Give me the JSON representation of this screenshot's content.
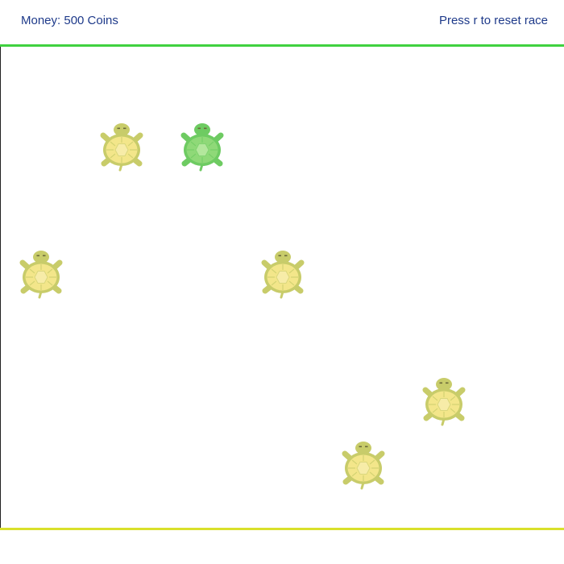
{
  "hud": {
    "money": "Money: 500 Coins",
    "reset_hint": "Press r to reset race"
  },
  "colors": {
    "text": "#1e3a8a",
    "start_line": "#3fd13f",
    "finish_line": "#d9e02b",
    "turtle_default_body": "#c8cc6a",
    "turtle_default_shell": "#f3e68a",
    "turtle_default_shell_center": "#f7eca8",
    "turtle_selected_body": "#6ecb62",
    "turtle_selected_shell": "#8fd978",
    "turtle_selected_shell_center": "#b3e79c"
  },
  "turtles": [
    {
      "id": "turtle-1",
      "icon": "turtle-icon",
      "selected": false
    },
    {
      "id": "turtle-2",
      "icon": "turtle-icon",
      "selected": true
    },
    {
      "id": "turtle-3",
      "icon": "turtle-icon",
      "selected": false
    },
    {
      "id": "turtle-4",
      "icon": "turtle-icon",
      "selected": false
    },
    {
      "id": "turtle-5",
      "icon": "turtle-icon",
      "selected": false
    },
    {
      "id": "turtle-6",
      "icon": "turtle-icon",
      "selected": false
    }
  ]
}
